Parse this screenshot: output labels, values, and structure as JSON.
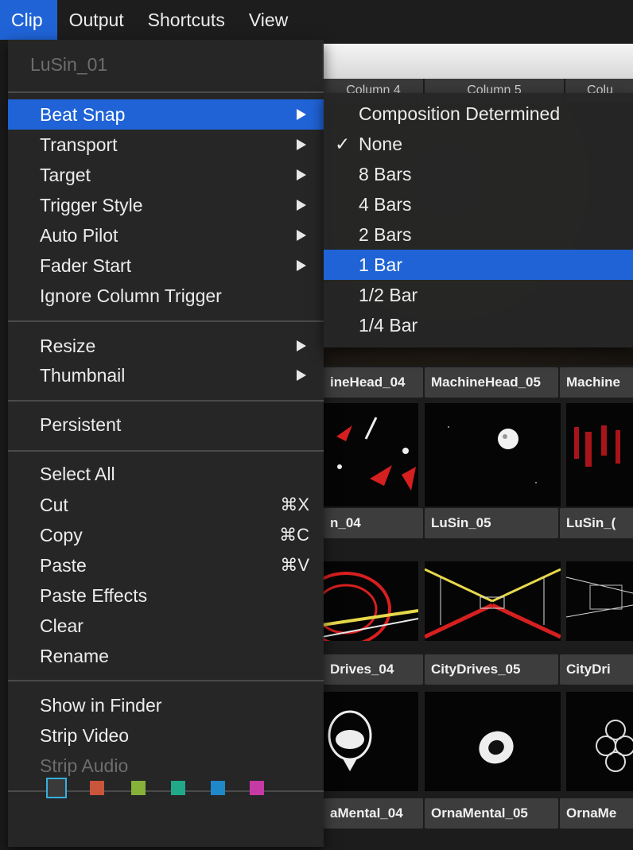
{
  "menubar": {
    "items": [
      {
        "label": "Clip",
        "active": true
      },
      {
        "label": "Output"
      },
      {
        "label": "Shortcuts"
      },
      {
        "label": "View"
      }
    ]
  },
  "background": {
    "columns": [
      "Column 4",
      "Column 5",
      "Colu"
    ],
    "rows": [
      {
        "labels": [
          "ineHead_04",
          "MachineHead_05",
          "Machine"
        ]
      },
      {
        "labels": [
          "n_04",
          "LuSin_05",
          "LuSin_("
        ]
      },
      {
        "labels": [
          "Drives_04",
          "CityDrives_05",
          "CityDri"
        ]
      },
      {
        "labels": [
          "aMental_04",
          "OrnaMental_05",
          "OrnaMe"
        ]
      }
    ]
  },
  "menu": {
    "header": "LuSin_01",
    "items": {
      "beat_snap": "Beat Snap",
      "transport": "Transport",
      "target": "Target",
      "trigger_style": "Trigger Style",
      "auto_pilot": "Auto Pilot",
      "fader_start": "Fader Start",
      "ignore_column_trigger": "Ignore Column Trigger",
      "resize": "Resize",
      "thumbnail": "Thumbnail",
      "persistent": "Persistent",
      "select_all": "Select All",
      "cut": "Cut",
      "copy": "Copy",
      "paste": "Paste",
      "paste_effects": "Paste Effects",
      "clear": "Clear",
      "rename": "Rename",
      "show_in_finder": "Show in Finder",
      "strip_video": "Strip Video",
      "strip_audio": "Strip Audio"
    },
    "shortcuts": {
      "cut": "⌘X",
      "copy": "⌘C",
      "paste": "⌘V"
    },
    "swatch_colors": [
      "#3a3a3a",
      "#c9553a",
      "#86b23a",
      "#20a889",
      "#1f88c8",
      "#c63aa6"
    ]
  },
  "submenu": {
    "items": [
      {
        "label": "Composition Determined",
        "checked": false
      },
      {
        "label": "None",
        "checked": true
      },
      {
        "label": "8 Bars",
        "checked": false
      },
      {
        "label": "4 Bars",
        "checked": false
      },
      {
        "label": "2 Bars",
        "checked": false
      },
      {
        "label": "1 Bar",
        "checked": false,
        "highlighted": true
      },
      {
        "label": "1/2 Bar",
        "checked": false
      },
      {
        "label": "1/4 Bar",
        "checked": false
      }
    ],
    "check_glyph": "✓"
  },
  "colors": {
    "highlight": "#1f63d6",
    "menu_bg": "#262626",
    "disabled_text": "#6d6d6d"
  }
}
